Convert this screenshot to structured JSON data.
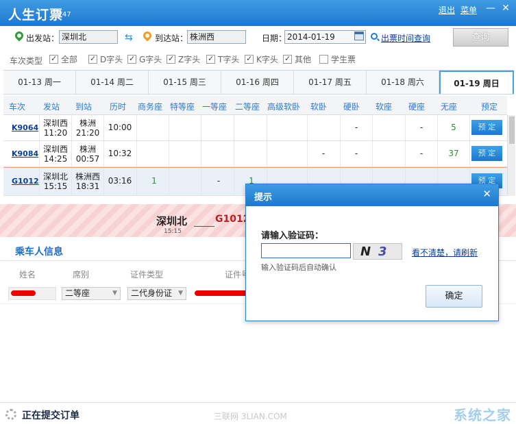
{
  "app": {
    "title": "人生订票",
    "version": "V47",
    "logout": "退出",
    "menu": "菜单",
    "minimize": "—",
    "close": "✕"
  },
  "search": {
    "from_label": "出发站：",
    "from_value": "深圳北",
    "to_label": "到达站：",
    "to_value": "株洲西",
    "date_label": "日期：",
    "date_value": "2014-01-19",
    "schedule_link": "出票时间查询",
    "query_button": "查询"
  },
  "filters": {
    "title": "车次类型",
    "items": [
      {
        "label": "全部",
        "checked": true
      },
      {
        "label": "D字头",
        "checked": true
      },
      {
        "label": "G字头",
        "checked": true
      },
      {
        "label": "Z字头",
        "checked": true
      },
      {
        "label": "T字头",
        "checked": true
      },
      {
        "label": "K字头",
        "checked": true
      },
      {
        "label": "其他",
        "checked": true
      },
      {
        "label": "学生票",
        "checked": false
      }
    ]
  },
  "date_tabs": [
    {
      "label": "01-13  周一"
    },
    {
      "label": "01-14  周二"
    },
    {
      "label": "01-15  周三"
    },
    {
      "label": "01-16  周四"
    },
    {
      "label": "01-17  周五"
    },
    {
      "label": "01-18  周六"
    },
    {
      "label": "01-19  周日",
      "active": true
    }
  ],
  "table": {
    "headers": [
      "车次",
      "发站",
      "到站",
      "历时",
      "商务座",
      "特等座",
      "一等座",
      "二等座",
      "高级软卧",
      "软卧",
      "硬卧",
      "软座",
      "硬座",
      "无座",
      "预定"
    ],
    "rows": [
      {
        "train": "K9064",
        "from": "深圳西",
        "dep": "11:20",
        "to": "株洲",
        "arr": "21:20",
        "duration": "10:00",
        "hard_sleeper": "-",
        "hard_seat": "-",
        "no_seat": "5",
        "book": "预 定"
      },
      {
        "train": "K9084",
        "from": "深圳西",
        "dep": "14:25",
        "to": "株洲",
        "arr": "00:57",
        "duration": "10:32",
        "soft_sleeper": "-",
        "hard_sleeper": "-",
        "hard_seat": "-",
        "no_seat": "37",
        "book": "预 定"
      },
      {
        "train": "G1012",
        "from": "深圳北",
        "dep": "15:15",
        "to": "株洲西",
        "arr": "18:31",
        "duration": "03:16",
        "business": "1",
        "first": "-",
        "second": "1",
        "book": "预 定"
      }
    ]
  },
  "banner": {
    "from": "深圳北",
    "time": "15:15",
    "train": "G1012"
  },
  "passenger": {
    "title": "乘车人信息",
    "headers": [
      "姓名",
      "席别",
      "证件类型",
      "证件号"
    ],
    "seat": "二等座",
    "id_type": "二代身份证"
  },
  "status": {
    "text": "正在提交订单"
  },
  "watermarks": {
    "site": "三联网 3LIAN.COM",
    "tag": "系统之家"
  },
  "dialog": {
    "title": "提示",
    "label": "请输入验证码：",
    "captcha_text_1": "N",
    "captcha_text_2": "3",
    "refresh_link": "看不清楚，请刷新",
    "hint": "输入验证码后自动确认",
    "ok": "确定"
  },
  "colors": {
    "accent": "#1e78cf",
    "link": "#0b3e9a",
    "header_text": "#2b7bd8",
    "available": "#2b8f2b",
    "banner_train": "#c81c1c"
  }
}
